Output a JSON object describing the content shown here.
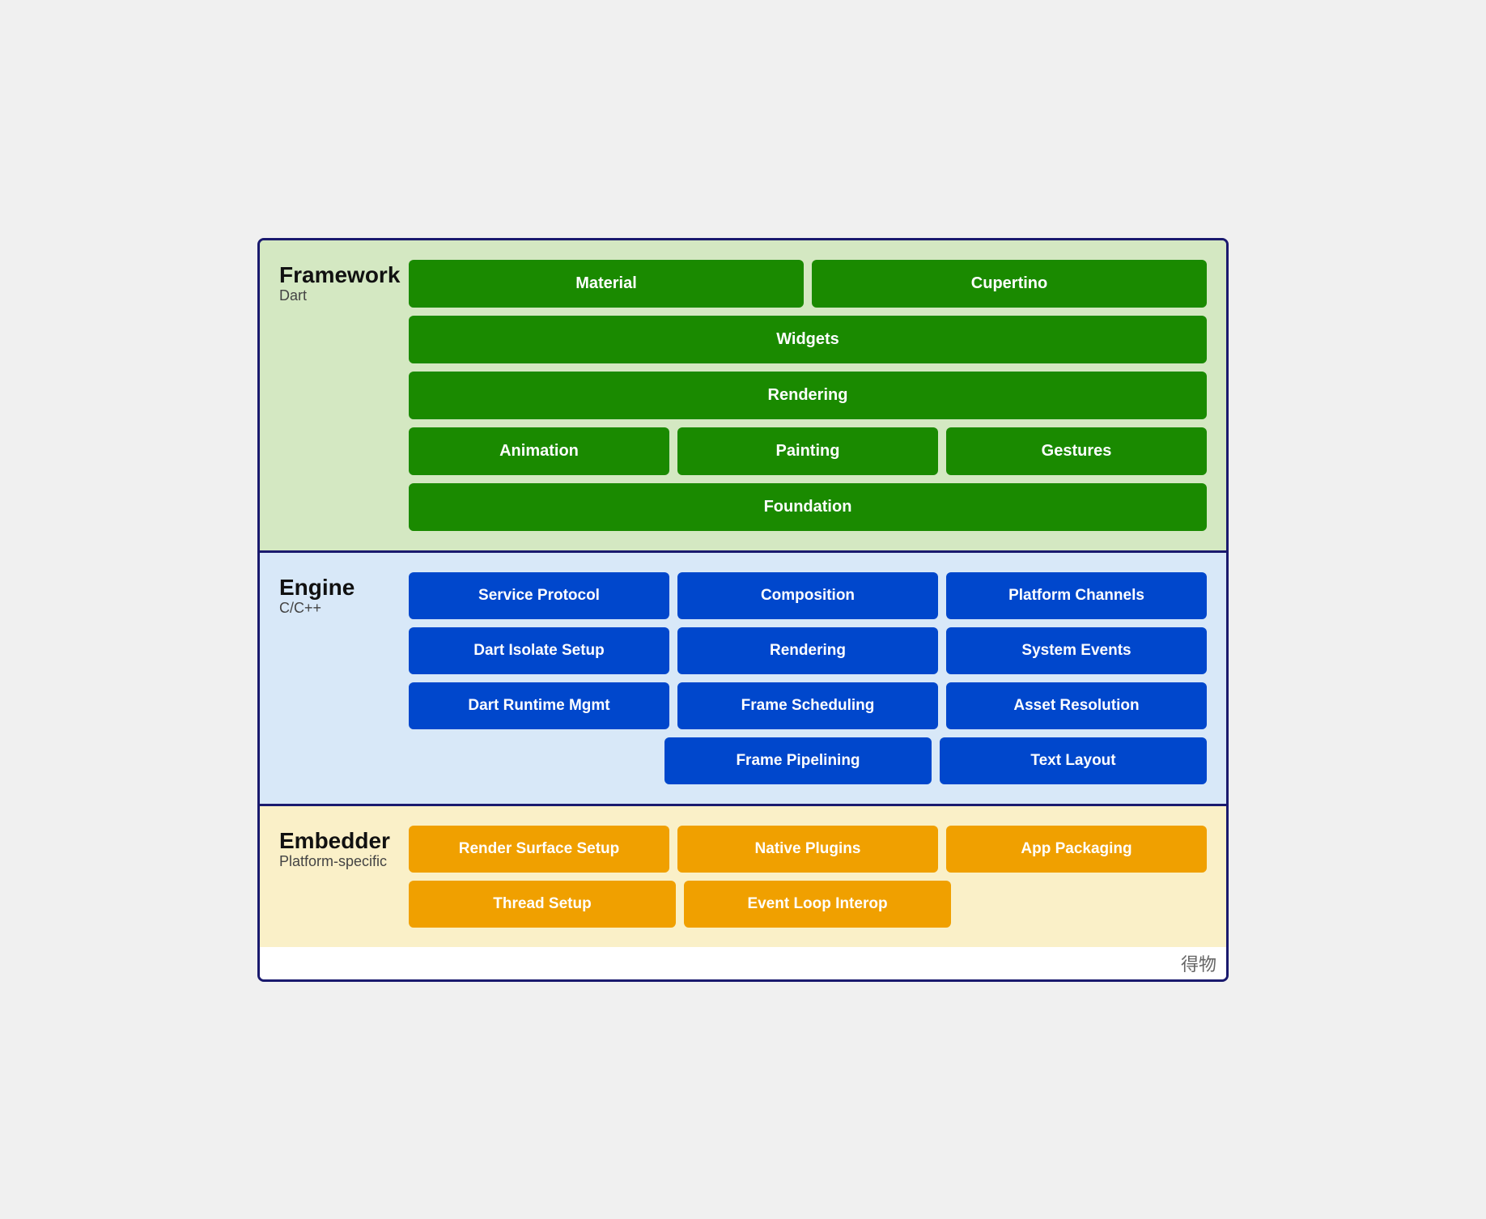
{
  "framework": {
    "title": "Framework",
    "subtitle": "Dart",
    "rows": [
      [
        {
          "label": "Material",
          "flex": 1
        },
        {
          "label": "Cupertino",
          "flex": 1
        }
      ],
      [
        {
          "label": "Widgets",
          "flex": 1
        }
      ],
      [
        {
          "label": "Rendering",
          "flex": 1
        }
      ],
      [
        {
          "label": "Animation",
          "flex": 1
        },
        {
          "label": "Painting",
          "flex": 1
        },
        {
          "label": "Gestures",
          "flex": 1
        }
      ],
      [
        {
          "label": "Foundation",
          "flex": 1
        }
      ]
    ]
  },
  "engine": {
    "title": "Engine",
    "subtitle": "C/C++",
    "rows": [
      [
        {
          "label": "Service Protocol",
          "flex": 1
        },
        {
          "label": "Composition",
          "flex": 1
        },
        {
          "label": "Platform Channels",
          "flex": 1
        }
      ],
      [
        {
          "label": "Dart Isolate Setup",
          "flex": 1
        },
        {
          "label": "Rendering",
          "flex": 1
        },
        {
          "label": "System Events",
          "flex": 1
        }
      ],
      [
        {
          "label": "Dart Runtime Mgmt",
          "flex": 1
        },
        {
          "label": "Frame Scheduling",
          "flex": 1
        },
        {
          "label": "Asset Resolution",
          "flex": 1
        }
      ],
      [
        {
          "label": "",
          "flex": 1,
          "empty": true
        },
        {
          "label": "Frame Pipelining",
          "flex": 1
        },
        {
          "label": "Text Layout",
          "flex": 1
        }
      ]
    ]
  },
  "embedder": {
    "title": "Embedder",
    "subtitle": "Platform-specific",
    "rows": [
      [
        {
          "label": "Render Surface Setup",
          "flex": 1
        },
        {
          "label": "Native Plugins",
          "flex": 1
        },
        {
          "label": "App Packaging",
          "flex": 1
        }
      ],
      [
        {
          "label": "Thread Setup",
          "flex": 1
        },
        {
          "label": "Event Loop Interop",
          "flex": 1
        },
        {
          "label": "",
          "flex": 1,
          "empty": true
        }
      ]
    ]
  },
  "watermark": "得物"
}
